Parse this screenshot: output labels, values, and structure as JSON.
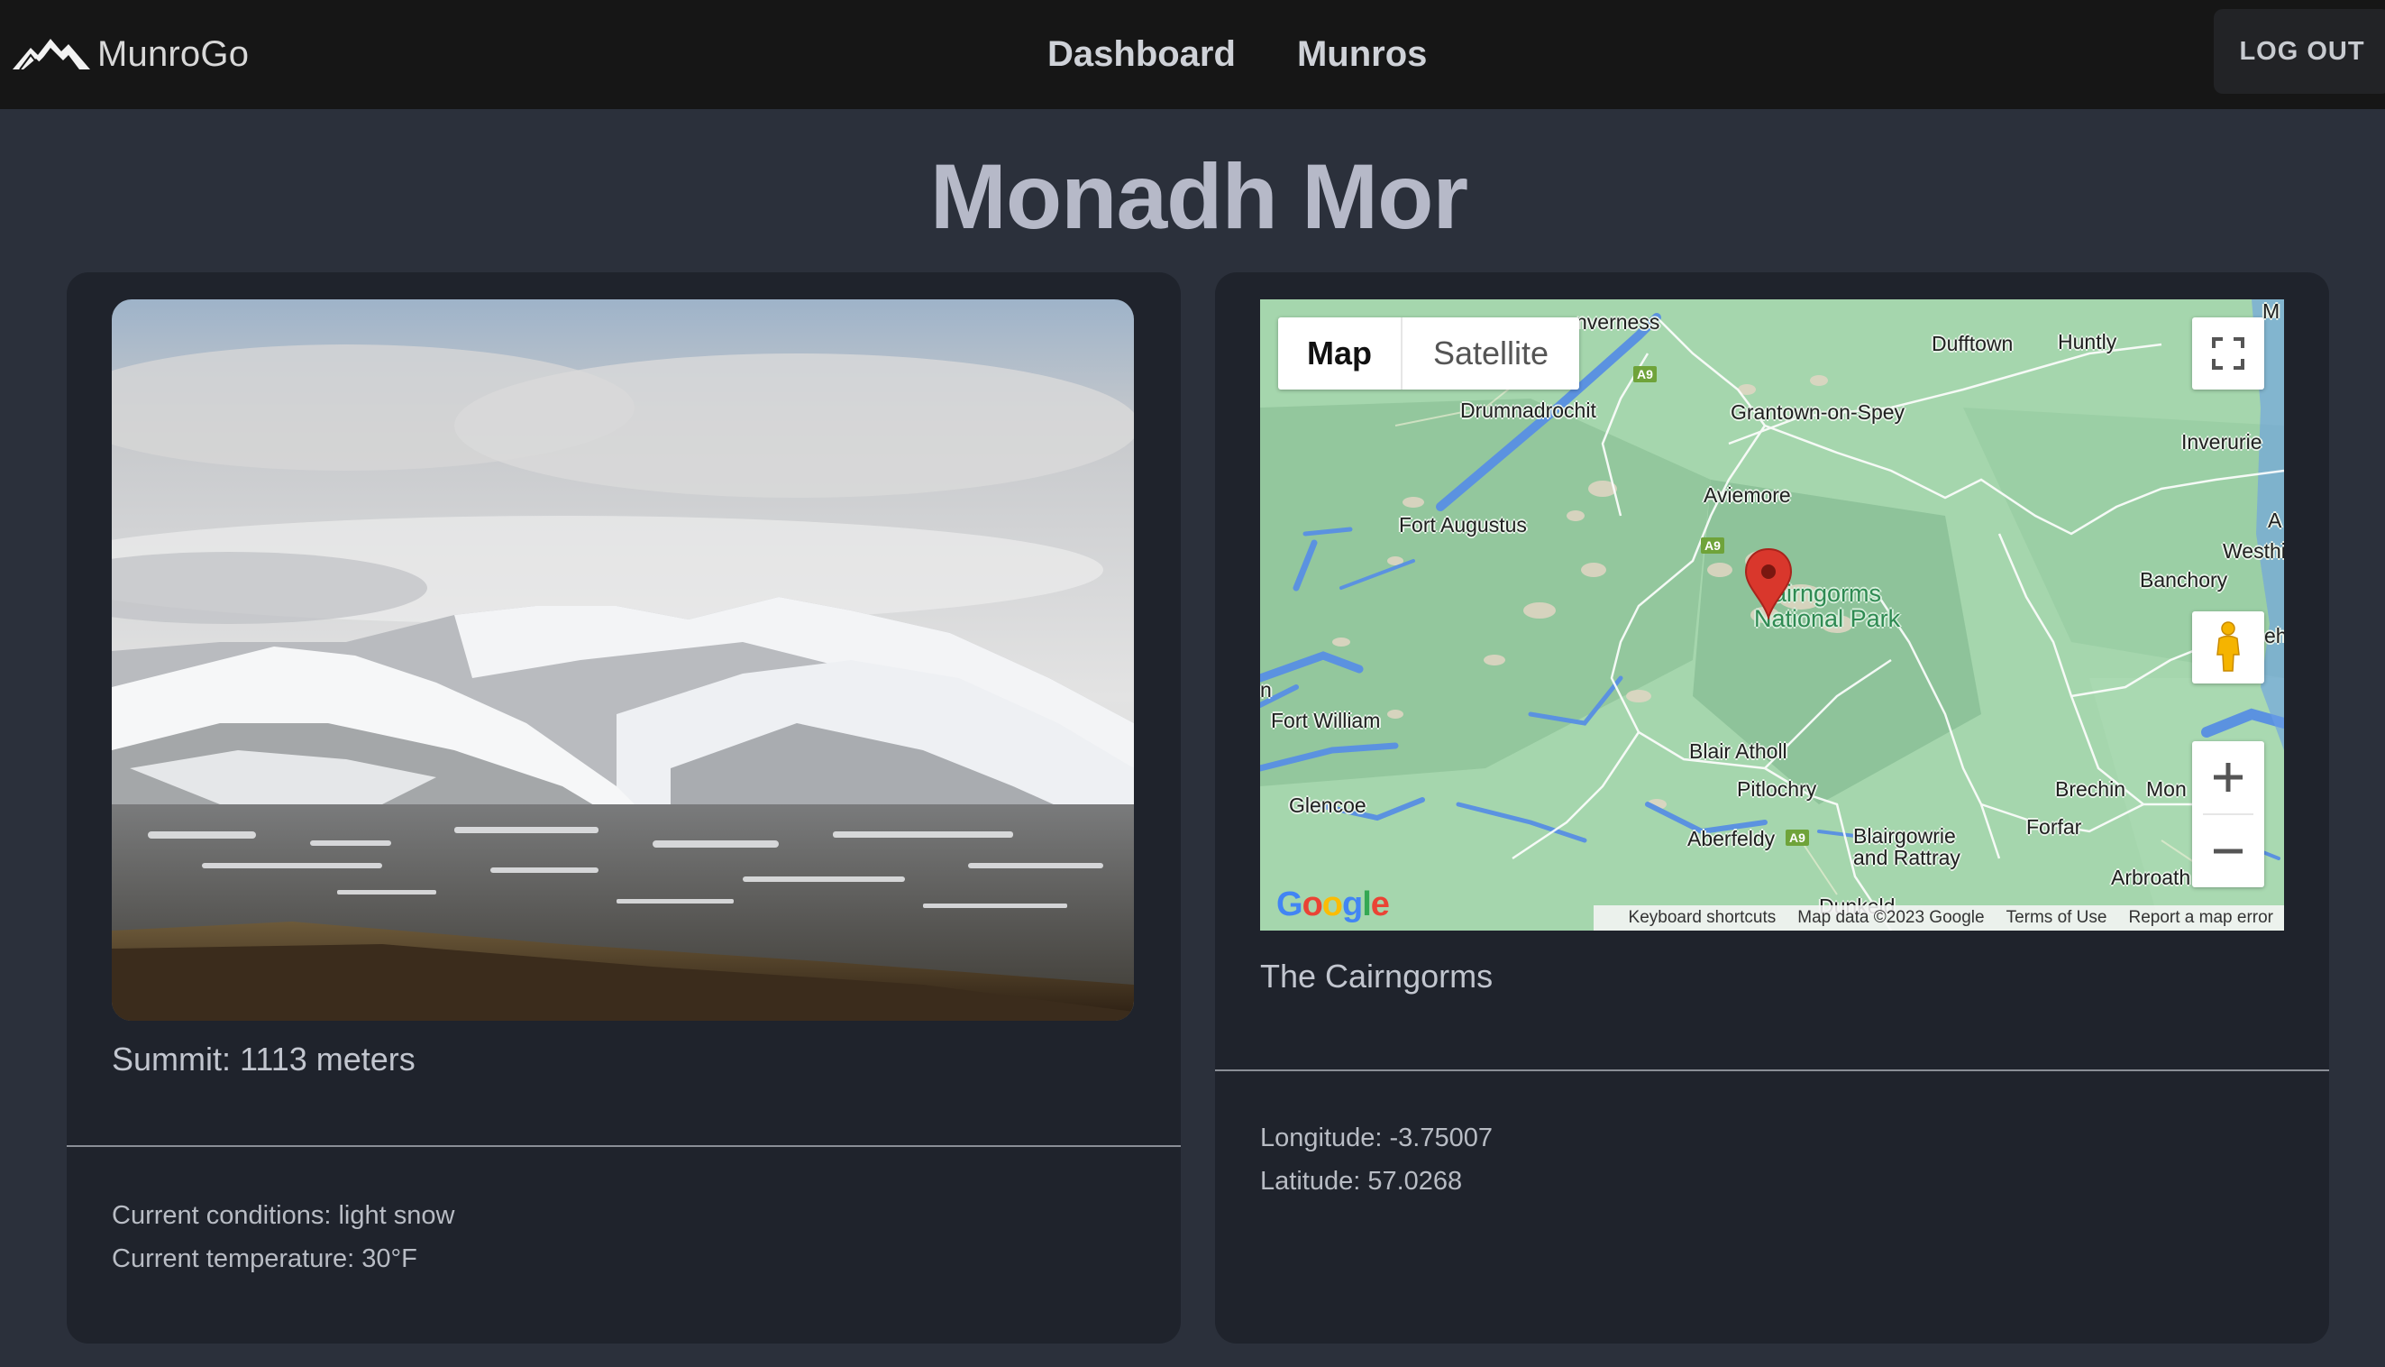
{
  "navbar": {
    "brand": "MunroGo",
    "brand_icon": "mountains-icon",
    "links": [
      "Dashboard",
      "Munros"
    ],
    "logout_label": "LOG OUT"
  },
  "munro": {
    "name": "Monadh Mor",
    "summit": "Summit: 1113 meters",
    "conditions": "Current conditions: light snow",
    "temperature": "Current temperature: 30°F",
    "region": "The Cairngorms",
    "longitude": "Longitude: -3.75007",
    "latitude": "Latitude: 57.0268"
  },
  "map": {
    "type_options": [
      "Map",
      "Satellite"
    ],
    "selected_type": "Map",
    "zoom_in": "+",
    "zoom_out": "−",
    "park_label_1": "airngorms",
    "park_label_2": "National Park",
    "road_label": "A9",
    "places": [
      "nverness",
      "Dufftown",
      "Huntly",
      "M",
      "Drumnadrochit",
      "Grantown-on-Spey",
      "Inverurie",
      "Aviemore",
      "Fort Augustus",
      "A",
      "Westhi",
      "Banchory",
      "eh",
      "n",
      "Fort William",
      "Blair Atholl",
      "Pitlochry",
      "Brechin",
      "Mon",
      "Glencoe",
      "Aberfeldy",
      "Blairgowrie",
      "and Rattray",
      "Forfar",
      "Arbroath",
      "Dunkeld"
    ],
    "attribution": {
      "shortcuts": "Keyboard shortcuts",
      "data": "Map data ©2023 Google",
      "terms": "Terms of Use",
      "report": "Report a map error"
    },
    "logo": "Google",
    "colors": {
      "land": "#9fd3a9",
      "water": "#6a9fe6",
      "marker": "#d9372c"
    }
  }
}
